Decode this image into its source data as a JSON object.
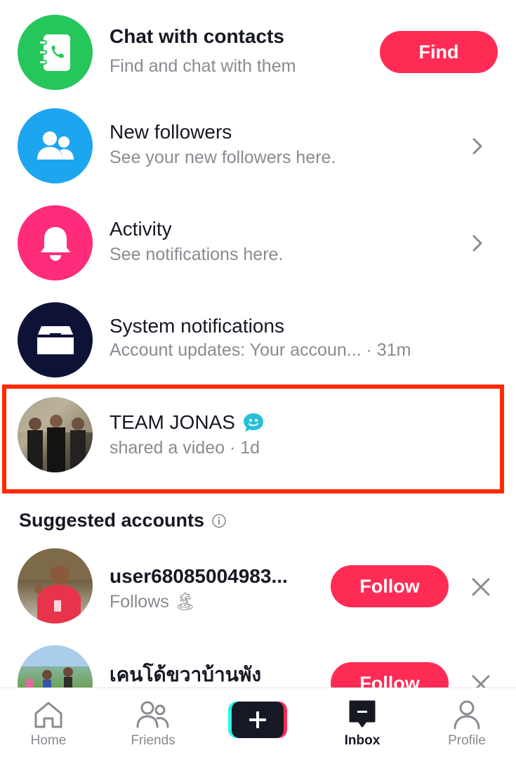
{
  "contacts": {
    "title": "Chat with contacts",
    "subtitle": "Find and chat with them",
    "button": "Find",
    "icon": "contact-book-icon",
    "color": "#25c65b"
  },
  "new_followers": {
    "title": "New followers",
    "subtitle": "See your new followers here.",
    "icon": "people-icon",
    "color": "#1da6f0"
  },
  "activity": {
    "title": "Activity",
    "subtitle": "See notifications here.",
    "icon": "bell-icon",
    "color": "#fe2c7a"
  },
  "system": {
    "title": "System notifications",
    "subtitle": "Account updates: Your accoun... · 31m",
    "icon": "inbox-tray-icon",
    "color": "#0e1236"
  },
  "message": {
    "name": "TEAM JONAS",
    "subtitle": "shared a video · 1d",
    "badge_icon": "smiley-bubble-icon",
    "highlight_color": "#ff2a00"
  },
  "suggested": {
    "heading": "Suggested accounts",
    "accounts": [
      {
        "name": "user68085004983...",
        "subtitle": "Follows 🏝",
        "button": "Follow"
      },
      {
        "name": "เคนโด้ขวาบ้านพัง",
        "subtitle": "",
        "button": "Follow"
      }
    ]
  },
  "nav": {
    "items": [
      {
        "label": "Home",
        "icon": "home-icon"
      },
      {
        "label": "Friends",
        "icon": "friends-icon"
      },
      {
        "label": "",
        "icon": "plus-icon"
      },
      {
        "label": "Inbox",
        "icon": "inbox-icon",
        "active": true
      },
      {
        "label": "Profile",
        "icon": "profile-icon"
      }
    ]
  },
  "colors": {
    "accent": "#fe2c55",
    "text": "#161823",
    "muted": "#8a8b91"
  }
}
